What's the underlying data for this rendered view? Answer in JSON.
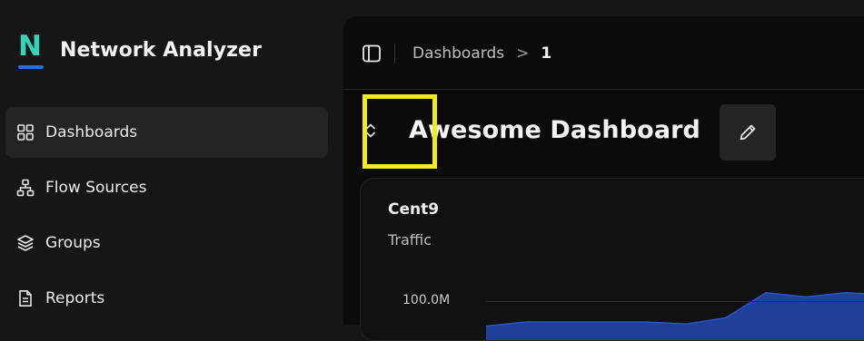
{
  "app": {
    "name": "Network Analyzer",
    "logo_letter": "N",
    "colors": {
      "accent": "#34d4b6",
      "logo_underline": "#2b6dd9",
      "highlight": "#f4e91d",
      "series": "#1f3f99"
    }
  },
  "sidebar": {
    "items": [
      {
        "label": "Dashboards",
        "icon": "grid-icon",
        "active": true
      },
      {
        "label": "Flow Sources",
        "icon": "network-icon",
        "active": false
      },
      {
        "label": "Groups",
        "icon": "layers-icon",
        "active": false
      },
      {
        "label": "Reports",
        "icon": "file-icon",
        "active": false
      }
    ]
  },
  "topbar": {
    "toggle_icon": "sidebar-toggle-icon",
    "breadcrumb": {
      "parent": "Dashboards",
      "separator": ">",
      "current": "1"
    }
  },
  "dashboard": {
    "title": "Awesome Dashboard",
    "expand_icon": "chevron-updown-icon",
    "edit_icon": "pencil-icon"
  },
  "card": {
    "title": "Cent9",
    "subtitle": "Traffic",
    "y_tick": "100.0M"
  },
  "chart_data": {
    "type": "area",
    "title": "Cent9",
    "subtitle": "Traffic",
    "y_ticks": [
      "100.0M"
    ],
    "series": [
      {
        "values": [
          88,
          90,
          90,
          90,
          90,
          89,
          92,
          104,
          102,
          104,
          103
        ]
      }
    ],
    "ymax_visible": 110
  }
}
